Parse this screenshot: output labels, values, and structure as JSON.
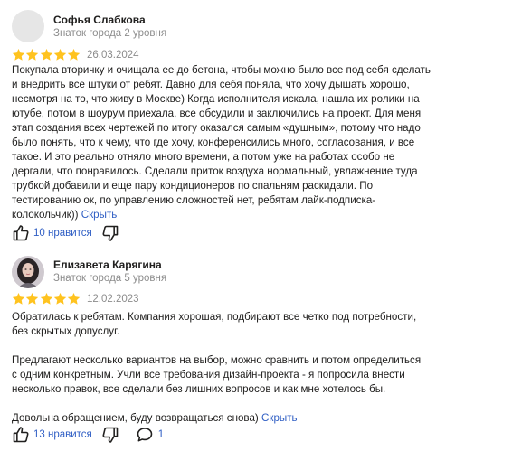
{
  "reviews": [
    {
      "author": "Софья Слабкова",
      "level": "Знаток города 2 уровня",
      "avatar": "empty-avatar",
      "rating": 5,
      "date": "26.03.2024",
      "paragraphs": [
        "Покупала вторичку и очищала ее до бетона, чтобы можно было все под себя сделать\nи внедрить все штуки от ребят. Давно для себя поняла, что хочу дышать хорошо,\nнесмотря на то, что живу в Москве) Когда исполнителя искала, нашла их ролики на\nютубе, потом в шоурум приехала, все обсудили и заключились на проект. Для меня\nэтап создания всех чертежей по итогу оказался самым «душным», потому что надо\nбыло понять, что к чему, что где хочу, конференсились много, согласования, и все\nтакое. И это реально отняло много времени, а потом уже на работах особо не\nдергали, что понравилось. Сделали приток воздуха нормальный, увлажнение туда\nтрубкой добавили и еще пару кондиционеров по спальням раскидали. По\nтестированию ок, по управлению сложностей нет, ребятам лайк-подписка-\nколокольчик))"
      ],
      "collapse_label": "Скрыть",
      "likes_label": "10 нравится"
    },
    {
      "author": "Елизавета Карягина",
      "level": "Знаток города 5 уровня",
      "avatar": "photo-avatar",
      "rating": 5,
      "date": "12.02.2023",
      "paragraphs": [
        "Обратилась к ребятам. Компания хорошая, подбирают все четко под потребности,\nбез скрытых допуслуг.",
        "Предлагают несколько вариантов на выбор, можно сравнить и потом определиться\nс одним конкретным. Учли все требования дизайн-проекта - я попросила внести\nнесколько правок, все сделали без лишних вопросов и как мне хотелось бы.",
        "Довольна обращением, буду возвращаться снова)"
      ],
      "collapse_label": "Скрыть",
      "likes_label": "13 нравится",
      "comments_count": "1"
    }
  ],
  "colors": {
    "star": "#ffc31f",
    "link": "#2f5ec4",
    "muted": "#8c8c8c",
    "icon": "#21201f"
  }
}
